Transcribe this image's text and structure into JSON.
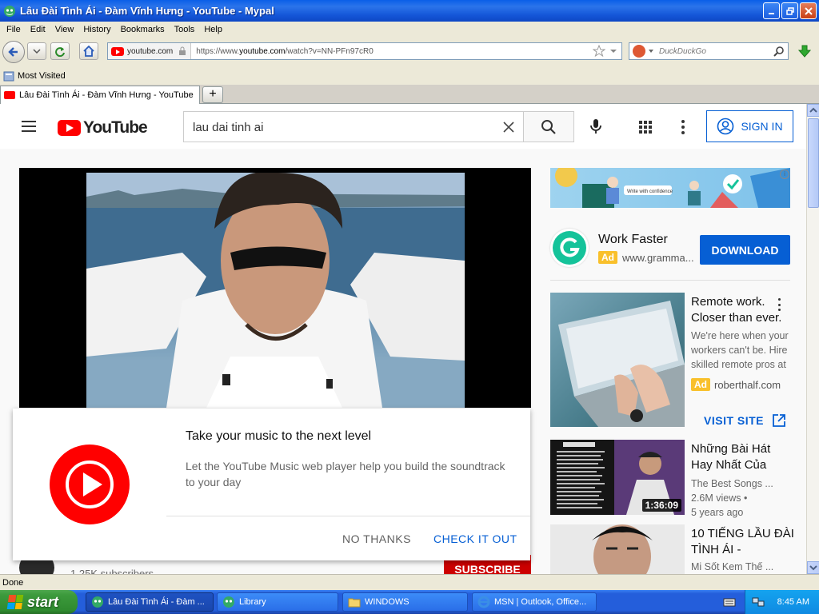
{
  "window": {
    "title": "Lâu Đài Tình Ái - Đàm Vĩnh Hưng - YouTube - Mypal"
  },
  "menu": [
    "File",
    "Edit",
    "View",
    "History",
    "Bookmarks",
    "Tools",
    "Help"
  ],
  "navbar": {
    "identity": "youtube.com",
    "url_prefix": "https://www.",
    "url_domain": "youtube.com",
    "url_rest": "/watch?v=NN-PFn97cR0",
    "search_placeholder": "DuckDuckGo"
  },
  "bookmarks": {
    "most_visited": "Most Visited"
  },
  "tabs": [
    {
      "label": "Lâu Đài Tình Ái - Đàm Vĩnh Hưng - YouTube"
    }
  ],
  "youtube": {
    "logo_text": "YouTube",
    "search_value": "lau dai tinh ai",
    "sign_in": "SIGN IN"
  },
  "ads": {
    "banner_text": "Write with confidence",
    "grammarly": {
      "title": "Work Faster",
      "badge": "Ad",
      "domain": "www.gramma...",
      "cta": "DOWNLOAD"
    },
    "roberthalf": {
      "title": "Remote work. Closer than ever.",
      "desc": "We're here when your workers can't be. Hire skilled remote pros at",
      "badge": "Ad",
      "domain": "roberthalf.com",
      "cta": "VISIT SITE"
    }
  },
  "related": [
    {
      "title": "Những Bài Hát Hay Nhất Của",
      "channel": "The Best Songs ...",
      "views": "2.6M views •",
      "age": "5 years ago",
      "duration": "1:36:09"
    },
    {
      "title": "10 TIẾNG LẦU ĐÀI TÌNH ÁI -",
      "channel": "Mi Sốt Kem Thế ..."
    }
  ],
  "channel": {
    "subscribers": "1.25K subscribers",
    "subscribe": "SUBSCRIBE"
  },
  "promo": {
    "title": "Take your music to the next level",
    "body": "Let the YouTube Music web player help you build the soundtrack to your day",
    "no_thanks": "NO THANKS",
    "check_it_out": "CHECK IT OUT"
  },
  "status": {
    "text": "Done"
  },
  "taskbar": {
    "start": "start",
    "tasks": [
      "Lâu Đài Tình Ái - Đàm ...",
      "Library",
      "WINDOWS",
      "MSN | Outlook, Office..."
    ],
    "clock": "8:45 AM"
  },
  "colors": {
    "yt_red": "#ff0000",
    "yt_blue": "#065fd4",
    "ad_yellow": "#f9c02b",
    "xp_blue": "#245edb"
  }
}
